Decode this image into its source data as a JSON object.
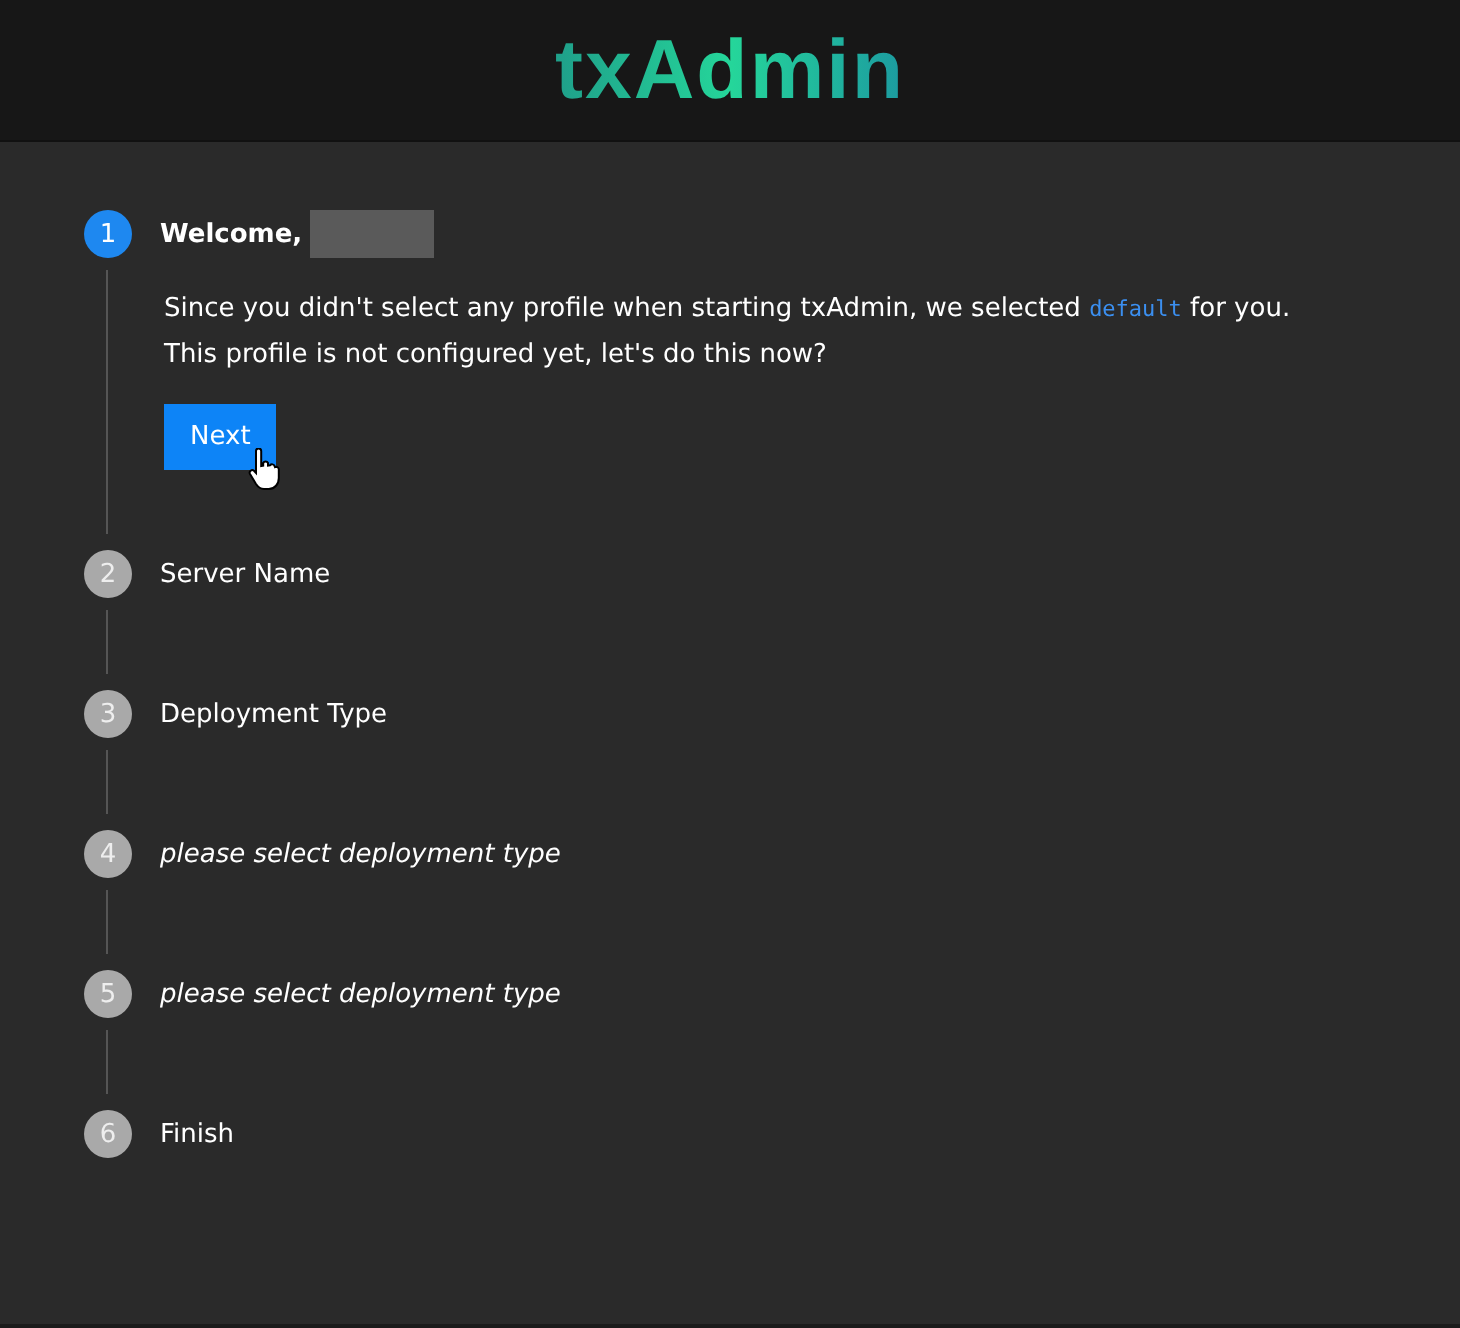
{
  "header": {
    "logo": "txAdmin"
  },
  "steps": [
    {
      "number": "1",
      "label": "Welcome,",
      "kind": "title",
      "selected": true,
      "redacted_name": true,
      "body": {
        "line_1_before": "Since you didn't select any profile when starting txAdmin, we selected",
        "code": "default",
        "line_1_after": "for you.",
        "line_2": "This profile is not configured yet, let's do this now?",
        "button": "Next"
      }
    },
    {
      "number": "2",
      "label": "Server Name",
      "kind": "title",
      "selected": false
    },
    {
      "number": "3",
      "label": "Deployment Type",
      "kind": "title",
      "selected": false
    },
    {
      "number": "4",
      "label": "please select deployment type",
      "kind": "placeholder",
      "selected": false
    },
    {
      "number": "5",
      "label": "please select deployment type",
      "kind": "placeholder",
      "selected": false
    },
    {
      "number": "6",
      "label": "Finish",
      "kind": "title",
      "selected": false
    }
  ]
}
